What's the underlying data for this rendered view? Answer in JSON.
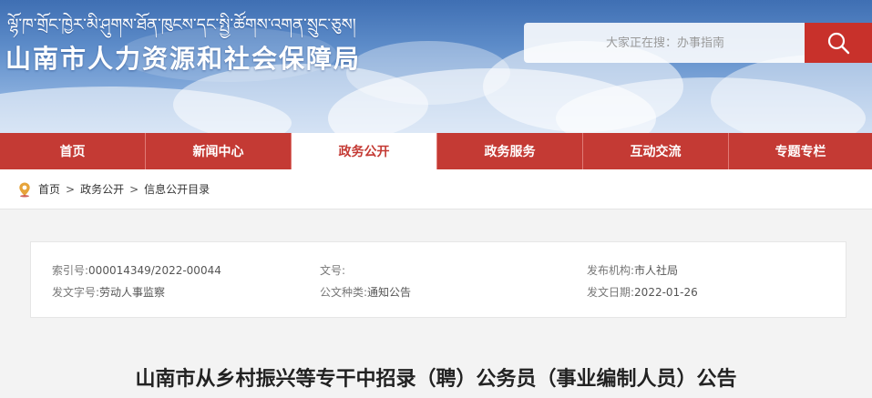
{
  "header": {
    "tibetan_title": "ལྷོ་ཁ་གྲོང་ཁྱེར་མི་ཤུགས་ཐོན་ཁུངས་དང་སྤྱི་ཚོགས་འགན་སྲུང་ཅུས།",
    "site_title": "山南市人力资源和社会保障局",
    "search_placeholder": "大家正在搜：办事指南"
  },
  "nav": {
    "items": [
      {
        "label": "首页"
      },
      {
        "label": "新闻中心"
      },
      {
        "label": "政务公开"
      },
      {
        "label": "政务服务"
      },
      {
        "label": "互动交流"
      },
      {
        "label": "专题专栏"
      }
    ],
    "active_index": 2
  },
  "breadcrumb": {
    "items": [
      "首页",
      "政务公开",
      "信息公开目录"
    ],
    "separator": ">"
  },
  "info": {
    "index_label": "索引号:",
    "index_value": "000014349/2022-00044",
    "doc_no_label": "文号:",
    "doc_no_value": "",
    "org_label": "发布机构:",
    "org_value": "市人社局",
    "word_label": "发文字号:",
    "word_value": "劳动人事监察",
    "type_label": "公文种类:",
    "type_value": "通知公告",
    "date_label": "发文日期:",
    "date_value": "2022-01-26"
  },
  "article": {
    "title": "山南市从乡村振兴等专干中招录（聘）公务员（事业编制人员）公告"
  },
  "colors": {
    "brand_red": "#c43a34",
    "search_red": "#c8312b",
    "banner_blue": "#4a7bbf"
  }
}
